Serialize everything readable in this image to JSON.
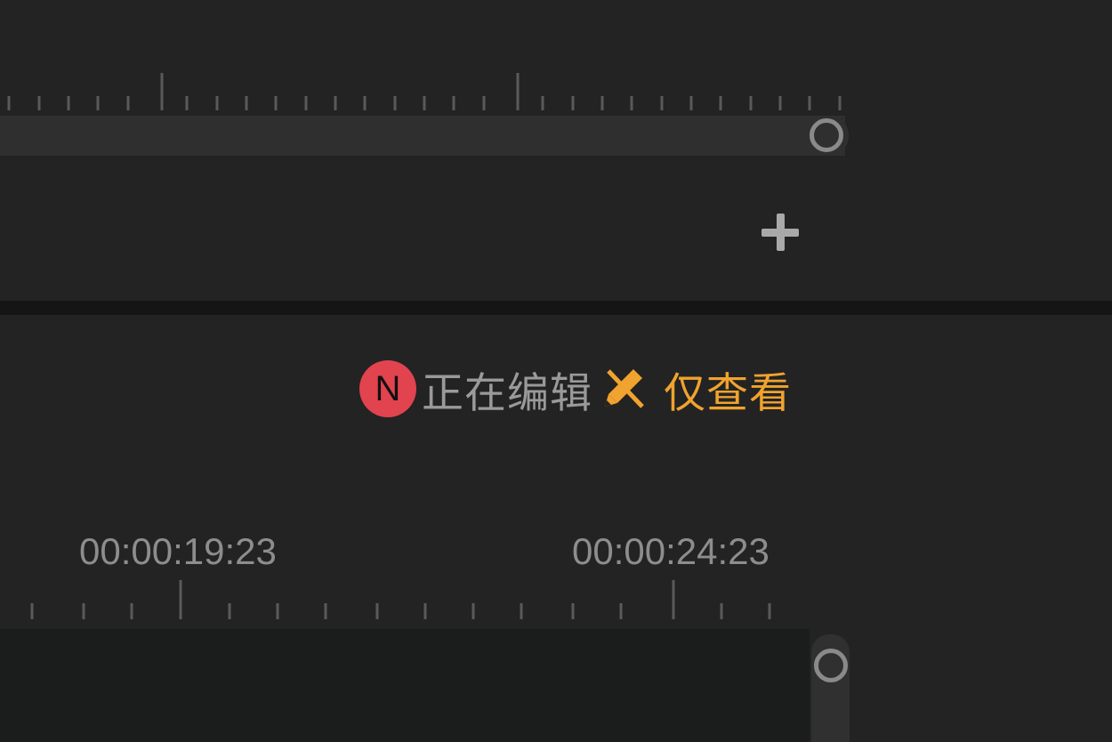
{
  "top_panel": {
    "add_button_icon": "plus-icon"
  },
  "status": {
    "user_initial": "N",
    "avatar_color": "#e1434f",
    "editing_label": "正在编辑",
    "pencil_icon": "pencil-crossed-icon",
    "view_only_label": "仅查看",
    "accent_color": "#f0a32e"
  },
  "timeline": {
    "timecodes": [
      "00:00:19:23",
      "00:00:24:23"
    ]
  }
}
